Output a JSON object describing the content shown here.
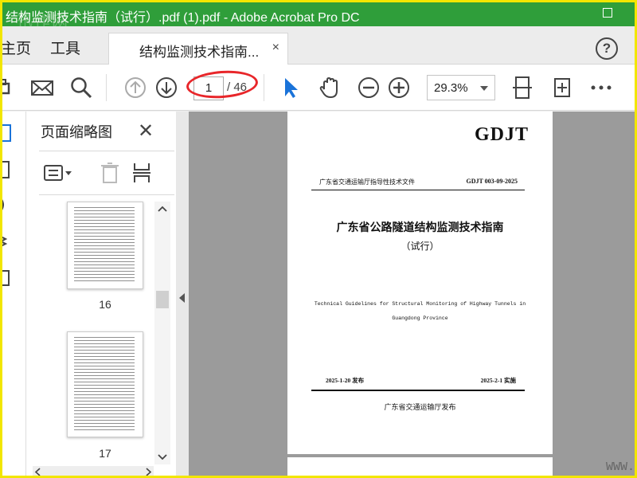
{
  "window": {
    "title": "结构监测技术指南（试行）.pdf (1).pdf - Adobe Acrobat Pro DC",
    "watermark": "迅作网"
  },
  "tabs": {
    "home": "主页",
    "tools": "工具",
    "document": "结构监测技术指南...",
    "document_close": "×",
    "help": "?"
  },
  "toolbar": {
    "page_current": "1",
    "page_total": "/ 46",
    "zoom": "29.3%"
  },
  "thumbnails": {
    "title": "页面缩略图",
    "close": "✕",
    "pages": [
      "16",
      "17"
    ]
  },
  "document": {
    "logo": "GDJT",
    "header_left": "广东省交通运输厅指导性技术文件",
    "header_right": "GDJT 003-09-2025",
    "title": "广东省公路隧道结构监测技术指南",
    "subtitle": "（试行）",
    "english_line1": "Technical Guidelines for Structural Monitoring of Highway Tunnels in",
    "english_line2": "Guangdong Province",
    "date_issued": "2025-1-20  发布",
    "date_effective": "2025-2-1  实施",
    "issuer": "广东省交通运输厅发布",
    "footer_watermark": "WWW."
  },
  "colors": {
    "titlebar": "#2f9e3a",
    "frame": "#f2e600",
    "annotation": "#e8262a",
    "select_tool": "#1a73d9"
  }
}
